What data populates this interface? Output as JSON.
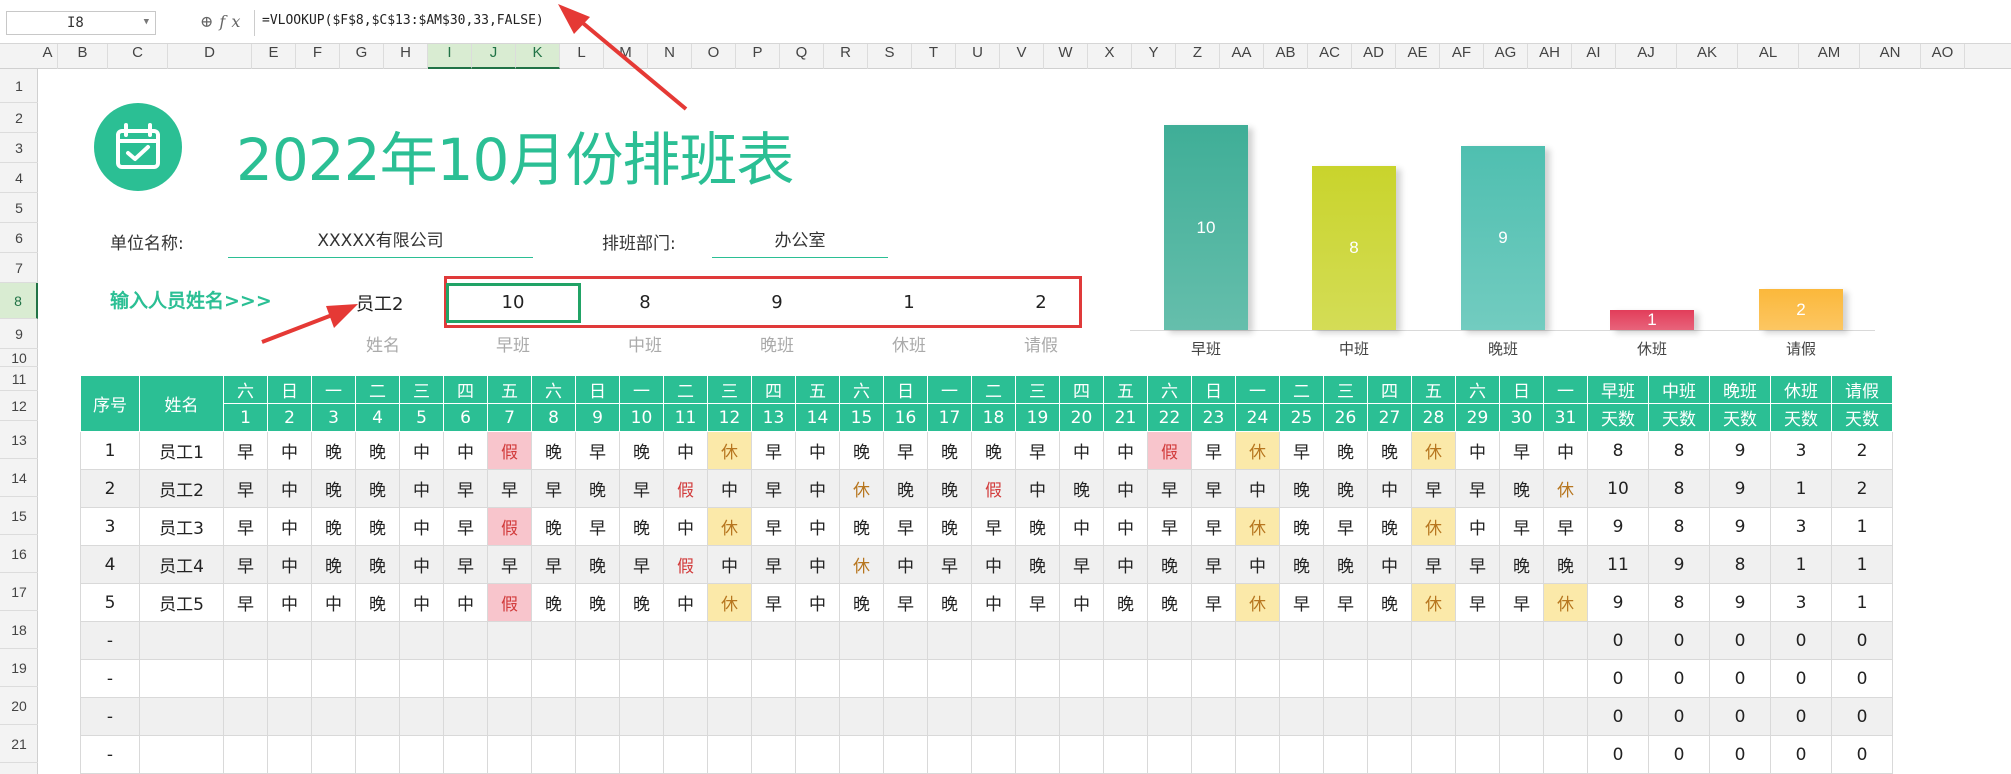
{
  "formula_bar": {
    "cell_ref": "I8",
    "fx": "fx",
    "formula": "=VLOOKUP($F$8,$C$13:$AM$30,33,FALSE)"
  },
  "columns": [
    "A",
    "B",
    "C",
    "D",
    "E",
    "F",
    "G",
    "H",
    "I",
    "J",
    "K",
    "L",
    "M",
    "N",
    "O",
    "P",
    "Q",
    "R",
    "S",
    "T",
    "U",
    "V",
    "W",
    "X",
    "Y",
    "Z",
    "AA",
    "AB",
    "AC",
    "AD",
    "AE",
    "AF",
    "AG",
    "AH",
    "AI",
    "AJ",
    "AK",
    "AL",
    "AM",
    "AN",
    "AO"
  ],
  "rows": [
    "1",
    "2",
    "3",
    "4",
    "5",
    "6",
    "7",
    "8",
    "9",
    "10",
    "11",
    "12",
    "13",
    "14",
    "15",
    "16",
    "17",
    "18",
    "19",
    "20",
    "21"
  ],
  "title": "2022年10月份排班表",
  "company_label": "单位名称:",
  "company_value": "XXXXX有限公司",
  "dept_label": "排班部门:",
  "dept_value": "办公室",
  "prompt": "输入人员姓名>>>",
  "employee": "员工2",
  "summary": {
    "values": [
      "10",
      "8",
      "9",
      "1",
      "2"
    ],
    "labels": [
      "早班",
      "中班",
      "晚班",
      "休班",
      "请假"
    ],
    "name_label": "姓名"
  },
  "chart_data": {
    "type": "bar",
    "categories": [
      "早班",
      "中班",
      "晚班",
      "休班",
      "请假"
    ],
    "values": [
      10,
      8,
      9,
      1,
      2
    ],
    "ylim": [
      0,
      10.5
    ],
    "colors": [
      "#3fae97",
      "#c9d42c",
      "#4fbfb0",
      "#e23d5a",
      "#fbb83b"
    ]
  },
  "table": {
    "h_seq": "序号",
    "h_name": "姓名",
    "weekdays": [
      "六",
      "日",
      "一",
      "二",
      "三",
      "四",
      "五",
      "六",
      "日",
      "一",
      "二",
      "三",
      "四",
      "五",
      "六",
      "日",
      "一",
      "二",
      "三",
      "四",
      "五",
      "六",
      "日",
      "一",
      "二",
      "三",
      "四",
      "五",
      "六",
      "日",
      "一"
    ],
    "days": [
      "1",
      "2",
      "3",
      "4",
      "5",
      "6",
      "7",
      "8",
      "9",
      "10",
      "11",
      "12",
      "13",
      "14",
      "15",
      "16",
      "17",
      "18",
      "19",
      "20",
      "21",
      "22",
      "23",
      "24",
      "25",
      "26",
      "27",
      "28",
      "29",
      "30",
      "31"
    ],
    "stat_top": [
      "早班",
      "中班",
      "晚班",
      "休班",
      "请假"
    ],
    "stat_bottom": [
      "天数",
      "天数",
      "天数",
      "天数",
      "天数"
    ],
    "rows": [
      {
        "seq": "1",
        "name": "员工1",
        "shifts": [
          "早",
          "中",
          "晚",
          "晚",
          "中",
          "中",
          "假",
          "晚",
          "早",
          "晚",
          "中",
          "休",
          "早",
          "中",
          "晚",
          "早",
          "晚",
          "晚",
          "早",
          "中",
          "中",
          "假",
          "早",
          "休",
          "早",
          "晚",
          "晚",
          "休",
          "中",
          "早",
          "中"
        ],
        "stats": [
          "8",
          "8",
          "9",
          "3",
          "2"
        ]
      },
      {
        "seq": "2",
        "name": "员工2",
        "shifts": [
          "早",
          "中",
          "晚",
          "晚",
          "中",
          "早",
          "早",
          "早",
          "晚",
          "早",
          "假",
          "中",
          "早",
          "中",
          "休",
          "晚",
          "晚",
          "假",
          "中",
          "晚",
          "中",
          "早",
          "早",
          "中",
          "晚",
          "晚",
          "中",
          "早",
          "早",
          "晚",
          "休"
        ],
        "stats": [
          "10",
          "8",
          "9",
          "1",
          "2"
        ]
      },
      {
        "seq": "3",
        "name": "员工3",
        "shifts": [
          "早",
          "中",
          "晚",
          "晚",
          "中",
          "早",
          "假",
          "晚",
          "早",
          "晚",
          "中",
          "休",
          "早",
          "中",
          "晚",
          "早",
          "晚",
          "早",
          "晚",
          "中",
          "中",
          "早",
          "早",
          "休",
          "晚",
          "早",
          "晚",
          "休",
          "中",
          "早",
          "早"
        ],
        "stats": [
          "9",
          "8",
          "9",
          "3",
          "1"
        ]
      },
      {
        "seq": "4",
        "name": "员工4",
        "shifts": [
          "早",
          "中",
          "晚",
          "晚",
          "中",
          "早",
          "早",
          "早",
          "晚",
          "早",
          "假",
          "中",
          "早",
          "中",
          "休",
          "中",
          "早",
          "中",
          "晚",
          "早",
          "中",
          "晚",
          "早",
          "中",
          "晚",
          "晚",
          "中",
          "早",
          "早",
          "晚",
          "晚"
        ],
        "stats": [
          "11",
          "9",
          "8",
          "1",
          "1"
        ]
      },
      {
        "seq": "5",
        "name": "员工5",
        "shifts": [
          "早",
          "中",
          "中",
          "晚",
          "中",
          "中",
          "假",
          "晚",
          "晚",
          "晚",
          "中",
          "休",
          "早",
          "中",
          "晚",
          "早",
          "晚",
          "中",
          "早",
          "中",
          "晚",
          "晚",
          "早",
          "休",
          "早",
          "早",
          "晚",
          "休",
          "早",
          "早",
          "休"
        ],
        "stats": [
          "9",
          "8",
          "9",
          "3",
          "1"
        ]
      },
      {
        "seq": "-",
        "name": "",
        "shifts": [],
        "stats": [
          "0",
          "0",
          "0",
          "0",
          "0"
        ]
      },
      {
        "seq": "-",
        "name": "",
        "shifts": [],
        "stats": [
          "0",
          "0",
          "0",
          "0",
          "0"
        ]
      },
      {
        "seq": "-",
        "name": "",
        "shifts": [],
        "stats": [
          "0",
          "0",
          "0",
          "0",
          "0"
        ]
      },
      {
        "seq": "-",
        "name": "",
        "shifts": [],
        "stats": [
          "0",
          "0",
          "0",
          "0",
          "0"
        ]
      }
    ]
  }
}
